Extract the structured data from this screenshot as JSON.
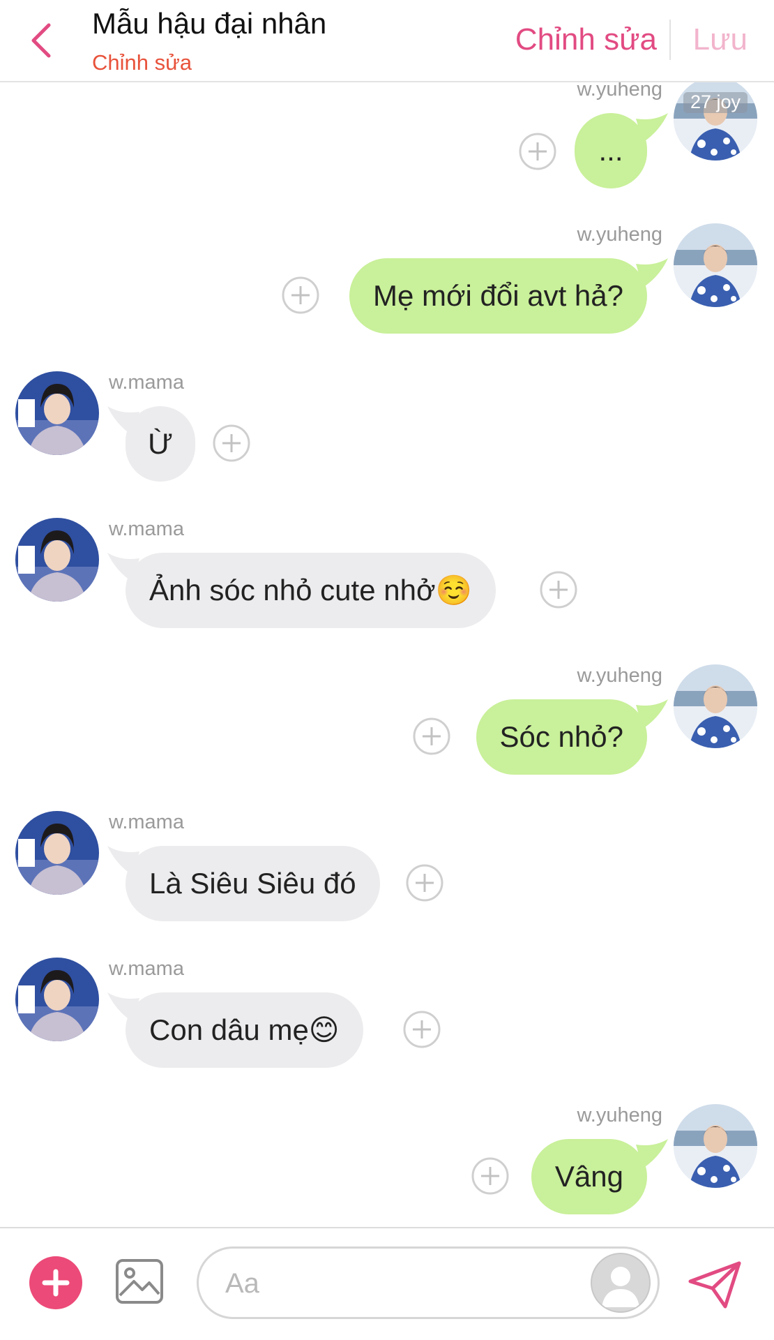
{
  "header": {
    "title": "Mẫu hậu đại nhân",
    "subtitle": "Chỉnh sửa",
    "edit_label": "Chỉnh sửa",
    "save_label": "Lưu"
  },
  "avatar_overlay": "27 joy",
  "messages": [
    {
      "side": "right",
      "name": "w.yuheng",
      "text": "..."
    },
    {
      "side": "right",
      "name": "w.yuheng",
      "text": "Mẹ mới đổi avt hả?"
    },
    {
      "side": "left",
      "name": "w.mama",
      "text": "Ừ"
    },
    {
      "side": "left",
      "name": "w.mama",
      "text": "Ảnh sóc nhỏ cute nhở☺️"
    },
    {
      "side": "right",
      "name": "w.yuheng",
      "text": "Sóc nhỏ?"
    },
    {
      "side": "left",
      "name": "w.mama",
      "text": "Là Siêu Siêu đó"
    },
    {
      "side": "left",
      "name": "w.mama",
      "text": "Con dâu mẹ😊"
    },
    {
      "side": "right",
      "name": "w.yuheng",
      "text": "Vâng"
    }
  ],
  "composer": {
    "placeholder": "Aa"
  },
  "colors": {
    "accent": "#e24b82",
    "subtitle": "#e8523b",
    "bubble_right": "#c9f09a",
    "bubble_left": "#ececee"
  },
  "icons": {
    "back": "chevron-left-icon",
    "add": "plus-circle-icon",
    "image": "image-icon",
    "send": "paper-plane-icon",
    "react": "plus-icon"
  }
}
